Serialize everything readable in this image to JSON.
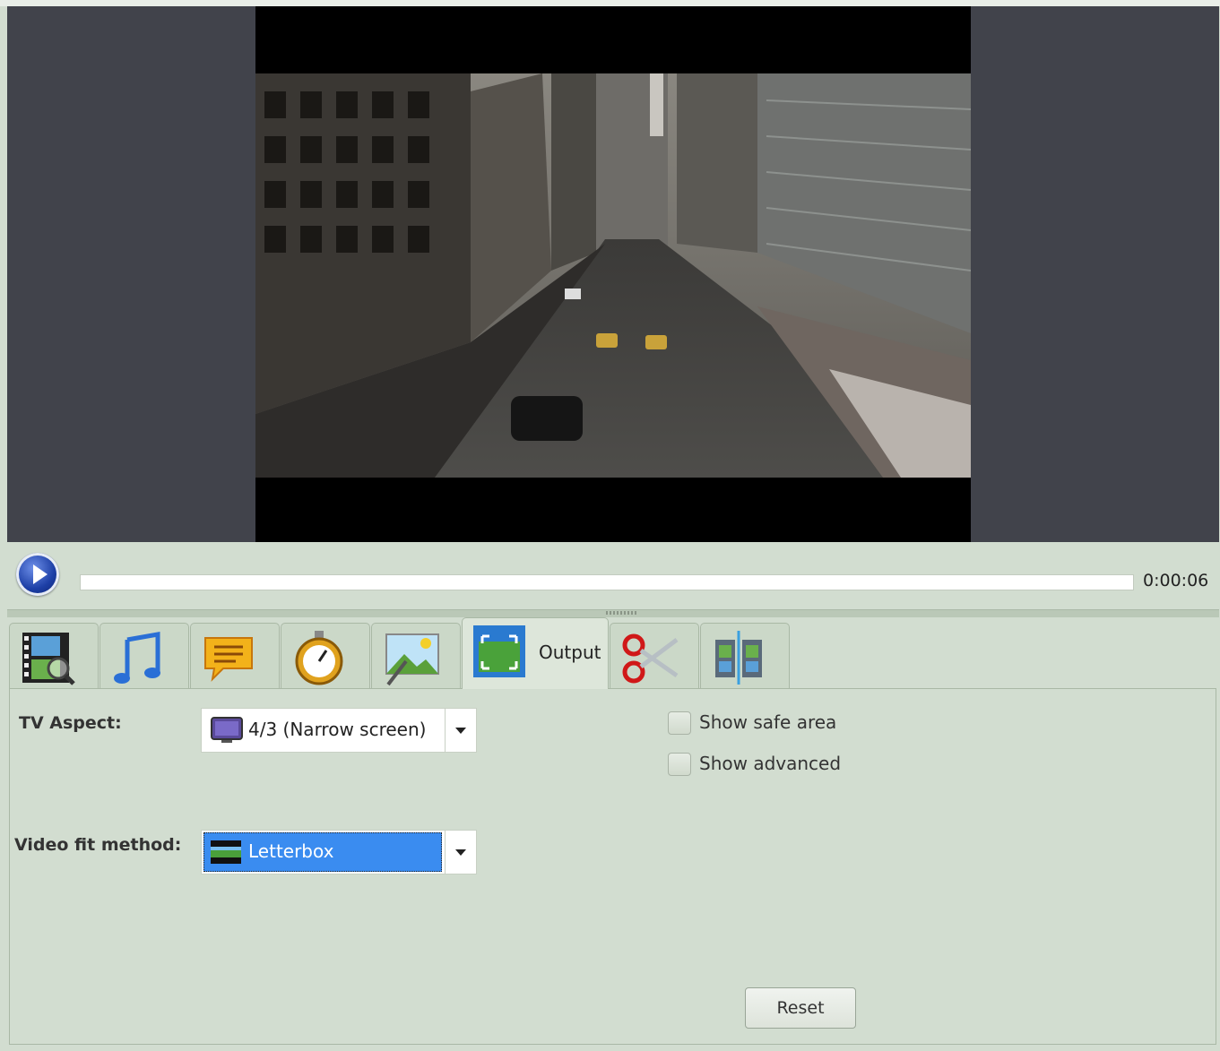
{
  "player": {
    "time": "0:00:06",
    "progress_fraction": 0.0,
    "play_icon": "play-icon"
  },
  "tabs": [
    {
      "name": "video-tab",
      "icon": "film-magnifier-icon",
      "label": ""
    },
    {
      "name": "audio-tab",
      "icon": "music-note-icon",
      "label": ""
    },
    {
      "name": "subtitles-tab",
      "icon": "speech-bubble-icon",
      "label": ""
    },
    {
      "name": "timing-tab",
      "icon": "stopwatch-icon",
      "label": ""
    },
    {
      "name": "image-tab",
      "icon": "picture-brush-icon",
      "label": ""
    },
    {
      "name": "output-tab",
      "icon": "fit-frame-icon",
      "label": "Output"
    },
    {
      "name": "cut-tab",
      "icon": "scissors-icon",
      "label": ""
    },
    {
      "name": "split-tab",
      "icon": "film-split-icon",
      "label": ""
    }
  ],
  "output": {
    "tv_aspect_label": "TV Aspect:",
    "tv_aspect_value": "4/3 (Narrow screen)",
    "video_fit_label": "Video fit method:",
    "video_fit_value": "Letterbox",
    "show_safe_area": "Show safe area",
    "show_advanced": "Show advanced",
    "reset": "Reset"
  },
  "colors": {
    "background": "#d2ddd0",
    "preview_bg": "#41434b",
    "selection": "#3a8cf0"
  }
}
